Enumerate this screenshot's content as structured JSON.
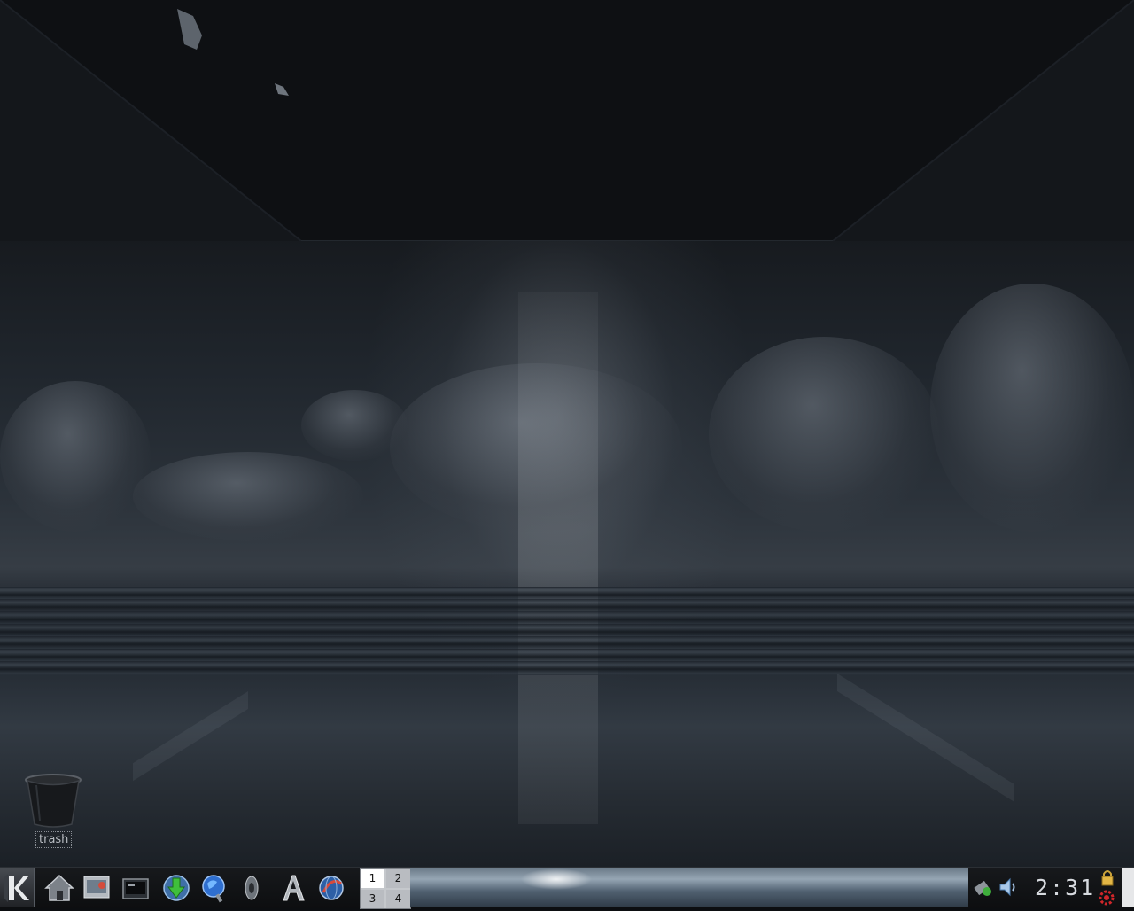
{
  "desktop": {
    "trash_label": "trash"
  },
  "taskbar": {
    "k_menu_icon": "kde-k-menu-icon",
    "launchers": [
      {
        "icon": "home-folder-icon"
      },
      {
        "icon": "control-center-icon"
      },
      {
        "icon": "terminal-icon"
      },
      {
        "icon": "download-manager-icon"
      },
      {
        "icon": "web-browser-icon"
      },
      {
        "icon": "audio-player-icon"
      },
      {
        "icon": "font-tool-icon"
      },
      {
        "icon": "internet-globe-icon"
      }
    ],
    "pager": {
      "desktops": [
        "1",
        "2",
        "3",
        "4"
      ],
      "active": "1"
    },
    "tray": {
      "network_icon": "network-icon",
      "volume_icon": "speaker-icon",
      "lock_icon": "lock-icon",
      "logout_icon": "logout-icon"
    },
    "clock": "2:31"
  }
}
